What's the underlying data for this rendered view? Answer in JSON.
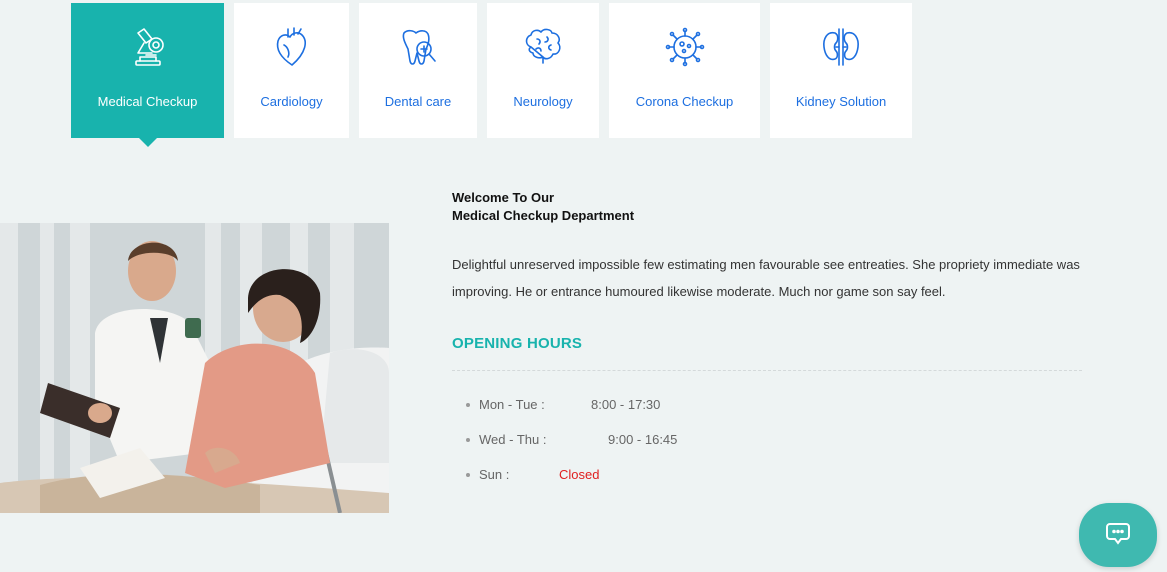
{
  "tabs": [
    {
      "label": "Medical Checkup",
      "icon": "microscope-icon",
      "active": true
    },
    {
      "label": "Cardiology",
      "icon": "heart-icon",
      "active": false
    },
    {
      "label": "Dental care",
      "icon": "tooth-icon",
      "active": false
    },
    {
      "label": "Neurology",
      "icon": "brain-icon",
      "active": false
    },
    {
      "label": "Corona Checkup",
      "icon": "virus-icon",
      "active": false
    },
    {
      "label": "Kidney Solution",
      "icon": "kidney-icon",
      "active": false
    }
  ],
  "content": {
    "welcome_line1": "Welcome To Our",
    "welcome_line2": "Medical Checkup Department",
    "description": "Delightful unreserved impossible few estimating men favourable see entreaties. She propriety immediate was improving. He or entrance humoured likewise moderate. Much nor game son say feel.",
    "hours_title": "OPENING HOURS",
    "hours": [
      {
        "day": "Mon - Tue :",
        "time": "8:00 - 17:30"
      },
      {
        "day": "Wed - Thu :",
        "time": "9:00 - 16:45"
      },
      {
        "day": "Sun :",
        "time": "Closed"
      }
    ]
  },
  "colors": {
    "accent": "#18b3ad",
    "tab_text": "#1d6fe0",
    "closed": "#e02020",
    "background": "#eef3f3"
  },
  "chat": {
    "icon": "chat-bubble-icon"
  }
}
